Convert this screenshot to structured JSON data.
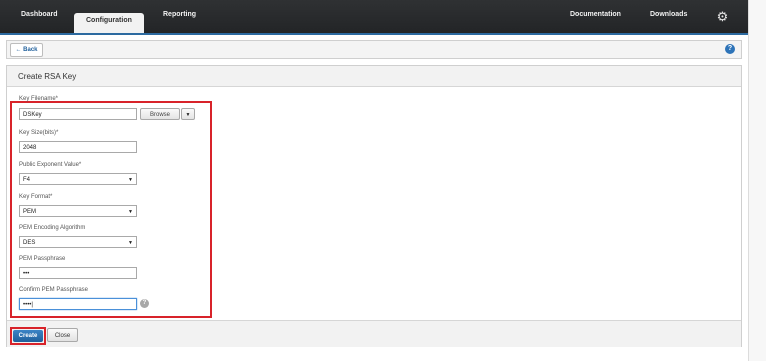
{
  "nav": {
    "tabs": [
      {
        "label": "Dashboard"
      },
      {
        "label": "Configuration"
      },
      {
        "label": "Reporting"
      }
    ],
    "right_links": [
      {
        "label": "Documentation"
      },
      {
        "label": "Downloads"
      }
    ],
    "settings_icon": "gear-icon",
    "active_tab": "Configuration",
    "accent_color": "#2c6aa0"
  },
  "toolbar": {
    "back_label": "← Back",
    "help_label": "?"
  },
  "panel": {
    "title": "Create RSA Key"
  },
  "form": {
    "key_filename": {
      "label": "Key Filename*",
      "value": "DSKey",
      "browse_label": "Browse",
      "dropdown_arrow": "▼"
    },
    "key_size": {
      "label": "Key Size(bits)*",
      "value": "2048"
    },
    "public_exponent": {
      "label": "Public Exponent Value*",
      "value": "F4",
      "arrow": "▼"
    },
    "key_format": {
      "label": "Key Format*",
      "value": "PEM",
      "arrow": "▼"
    },
    "pem_algorithm": {
      "label": "PEM Encoding Algorithm",
      "value": "DES",
      "arrow": "▼"
    },
    "pem_passphrase": {
      "label": "PEM Passphrase",
      "value": "•••"
    },
    "confirm_passphrase": {
      "label": "Confirm PEM Passphrase",
      "value": "••••|",
      "help": "?"
    }
  },
  "actions": {
    "create_label": "Create",
    "close_label": "Close"
  },
  "highlight_color": "#d8232a"
}
